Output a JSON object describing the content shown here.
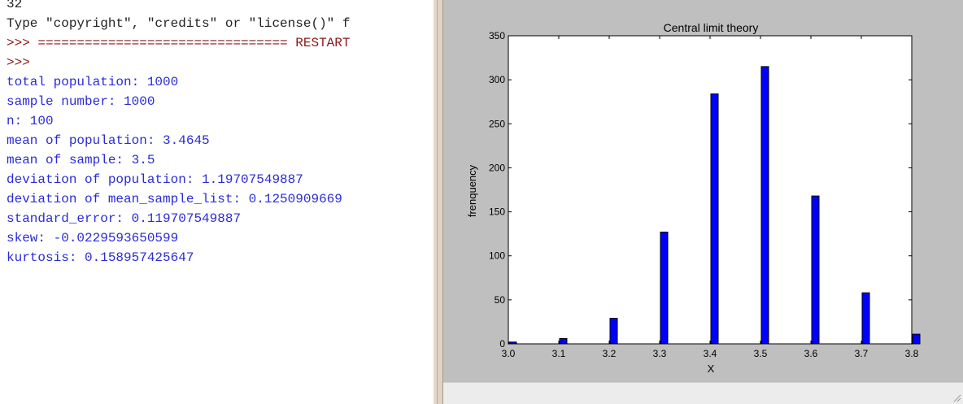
{
  "shell": {
    "lines": [
      {
        "text": "32",
        "kind": "plain"
      },
      {
        "text": "Type \"copyright\", \"credits\" or \"license()\" f",
        "kind": "plain"
      },
      {
        "text": ">>> ================================ RESTART",
        "kind": "prompt"
      },
      {
        "text": ">>>",
        "kind": "prompt"
      },
      {
        "text": "total population: 1000",
        "kind": "out"
      },
      {
        "text": "sample number: 1000",
        "kind": "out"
      },
      {
        "text": "n: 100",
        "kind": "out"
      },
      {
        "text": "mean of population: 3.4645",
        "kind": "out"
      },
      {
        "text": "mean of sample: 3.5",
        "kind": "out"
      },
      {
        "text": "deviation of population: 1.19707549887",
        "kind": "out"
      },
      {
        "text": "deviation of mean_sample_list: 0.1250909669",
        "kind": "out"
      },
      {
        "text": "standard_error: 0.119707549887",
        "kind": "out"
      },
      {
        "text": "skew: -0.0229593650599",
        "kind": "out"
      },
      {
        "text": "kurtosis: 0.158957425647",
        "kind": "out"
      }
    ]
  },
  "colors": {
    "prompt": "#8b1a1a",
    "output": "#2b2bd6",
    "bar": "#0000ff"
  },
  "chart_data": {
    "type": "bar",
    "title": "Central limit theory",
    "xlabel": "X",
    "ylabel": "frenquency",
    "xlim": [
      3.0,
      3.8
    ],
    "ylim": [
      0,
      350
    ],
    "x_ticks": [
      "3.0",
      "3.1",
      "3.2",
      "3.3",
      "3.4",
      "3.5",
      "3.6",
      "3.7",
      "3.8"
    ],
    "y_ticks": [
      "0",
      "50",
      "100",
      "150",
      "200",
      "250",
      "300",
      "350"
    ],
    "x": [
      3.0,
      3.1,
      3.2,
      3.3,
      3.4,
      3.5,
      3.6,
      3.7,
      3.8
    ],
    "values": [
      2,
      6,
      29,
      127,
      284,
      315,
      168,
      58,
      11
    ],
    "grid": false,
    "legend": "none"
  }
}
